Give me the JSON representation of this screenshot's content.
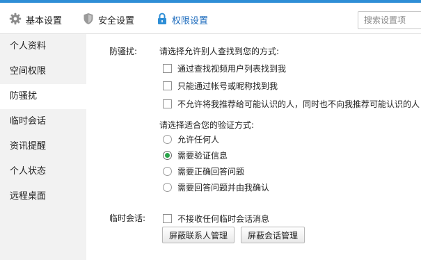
{
  "tabs": [
    {
      "label": "基本设置",
      "icon": "gear-icon"
    },
    {
      "label": "安全设置",
      "icon": "shield-icon"
    },
    {
      "label": "权限设置",
      "icon": "lock-icon",
      "active": true
    }
  ],
  "search": {
    "placeholder": "搜索设置项"
  },
  "sidebar": {
    "items": [
      {
        "label": "个人资料"
      },
      {
        "label": "空间权限"
      },
      {
        "label": "防骚扰",
        "active": true
      },
      {
        "label": "临时会话"
      },
      {
        "label": "资讯提醒"
      },
      {
        "label": "个人状态"
      },
      {
        "label": "远程桌面"
      }
    ]
  },
  "anti_harass": {
    "section_label": "防骚扰:",
    "find_prompt": "请选择允许别人查找到您的方式:",
    "find_options": [
      {
        "label": "通过查找视频用户列表找到我",
        "checked": false
      },
      {
        "label": "只能通过帐号或昵称找到我",
        "checked": false
      },
      {
        "label": "不允许将我推荐给可能认识的人，同时也不向我推荐可能认识的人",
        "checked": false
      }
    ],
    "verify_prompt": "请选择适合您的验证方式:",
    "verify_options": [
      {
        "label": "允许任何人",
        "selected": false
      },
      {
        "label": "需要验证信息",
        "selected": true
      },
      {
        "label": "需要正确回答问题",
        "selected": false
      },
      {
        "label": "需要回答问题并由我确认",
        "selected": false
      }
    ]
  },
  "temp_chat": {
    "section_label": "临时会话:",
    "option": {
      "label": "不接收任何临时会话消息",
      "checked": false
    },
    "block_contacts_button": "屏蔽联系人管理",
    "block_sessions_button": "屏蔽会话管理"
  },
  "colors": {
    "accent": "#1c6bbd",
    "top_border": "#2e8ed6",
    "radio_dot": "#2aa44a",
    "sidebar_bg": "#f2f2f2"
  }
}
